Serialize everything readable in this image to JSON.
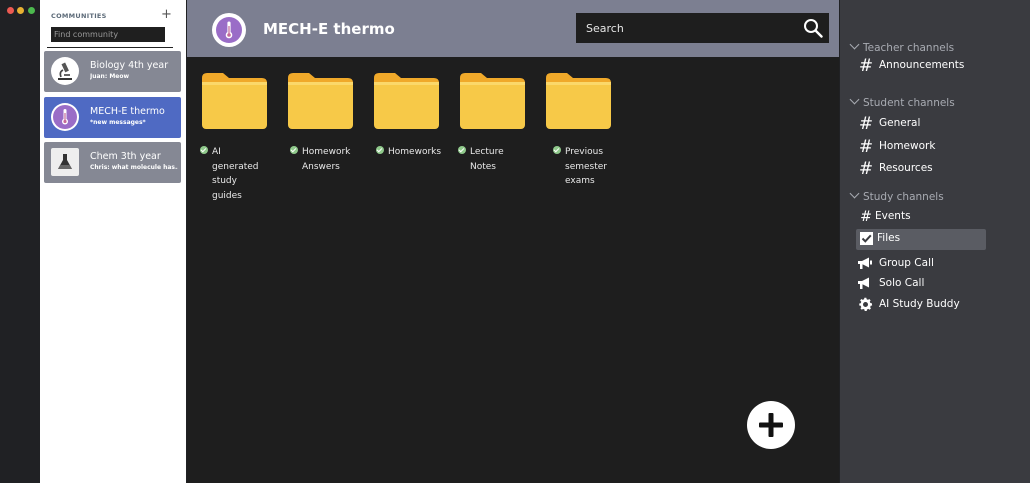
{
  "communities": {
    "heading": "COMMUNITIES",
    "add": "+",
    "search_placeholder": "Find community",
    "items": [
      {
        "title": "Biology 4th year",
        "subtitle": "Juan: Meow"
      },
      {
        "title": "MECH-E thermo",
        "subtitle": "*new messages*"
      },
      {
        "title": "Chem 3th year",
        "subtitle": "Chris: what molecule has..."
      }
    ]
  },
  "header": {
    "title": "MECH-E thermo",
    "search_placeholder": "Search"
  },
  "folders": [
    {
      "label_lines": [
        "AI generated",
        "study guides"
      ]
    },
    {
      "label_lines": [
        "Homework",
        "Answers"
      ]
    },
    {
      "label_lines": [
        "Homeworks"
      ]
    },
    {
      "label_lines": [
        "Lecture Notes"
      ]
    },
    {
      "label_lines": [
        "Previous",
        "semester",
        "exams"
      ]
    }
  ],
  "channels": {
    "teacher": {
      "title": "Teacher channels",
      "items": [
        {
          "label": "Announcements",
          "icon": "hash-icon"
        }
      ]
    },
    "student": {
      "title": "Student channels",
      "items": [
        {
          "label": "General",
          "icon": "hash-icon"
        },
        {
          "label": "Homework",
          "icon": "hash-icon"
        },
        {
          "label": "Resources",
          "icon": "hash-icon"
        }
      ]
    },
    "study": {
      "title": "Study channels",
      "items": [
        {
          "label": "Events",
          "icon": "events-icon"
        },
        {
          "label": "Files",
          "icon": "checkbox-icon"
        },
        {
          "label": "Group Call",
          "icon": "megaphone-icon"
        },
        {
          "label": "Solo Call",
          "icon": "megaphone-icon"
        },
        {
          "label": "AI Study Buddy",
          "icon": "gear-icon"
        }
      ]
    }
  },
  "colors": {
    "active_community": "#4f6ac3",
    "header_bg": "#7c7f91",
    "folder": "#f7c948",
    "check": "#8fc98b"
  }
}
